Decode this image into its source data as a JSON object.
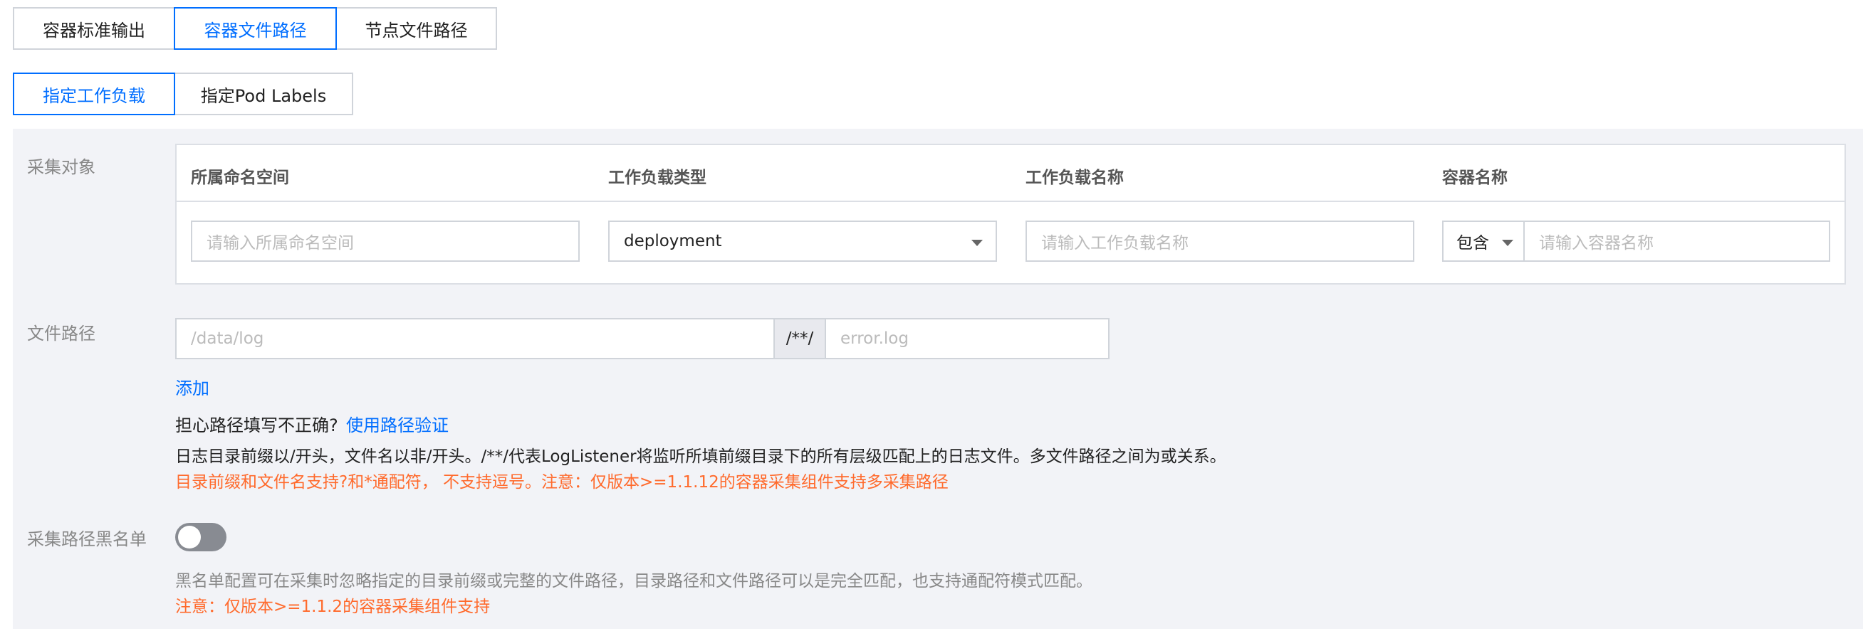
{
  "tabs_source": [
    {
      "label": "容器标准输出",
      "active": false
    },
    {
      "label": "容器文件路径",
      "active": true
    },
    {
      "label": "节点文件路径",
      "active": false
    }
  ],
  "tabs_target": [
    {
      "label": "指定工作负载",
      "active": true
    },
    {
      "label": "指定Pod Labels",
      "active": false
    }
  ],
  "collect_object": {
    "label": "采集对象",
    "headers": [
      "所属命名空间",
      "工作负载类型",
      "工作负载名称",
      "容器名称"
    ],
    "namespace_placeholder": "请输入所属命名空间",
    "workload_type_value": "deployment",
    "workload_name_placeholder": "请输入工作负载名称",
    "container_match_value": "包含",
    "container_name_placeholder": "请输入容器名称"
  },
  "file_path": {
    "label": "文件路径",
    "dir_placeholder": "/data/log",
    "separator": "/**/",
    "file_placeholder": "error.log",
    "add_link": "添加",
    "question": "担心路径填写不正确?",
    "verify_link": "使用路径验证",
    "hint": "日志目录前缀以/开头，文件名以非/开头。/**/代表LogListener将监听所填前缀目录下的所有层级匹配上的日志文件。多文件路径之间为或关系。",
    "warning": "目录前缀和文件名支持?和*通配符， 不支持逗号。注意：仅版本>=1.1.12的容器采集组件支持多采集路径"
  },
  "blacklist": {
    "label": "采集路径黑名单",
    "enabled": false,
    "hint": "黑名单配置可在采集时忽略指定的目录前缀或完整的文件路径，目录路径和文件路径可以是完全匹配，也支持通配符模式匹配。",
    "warning": "注意：仅版本>=1.1.2的容器采集组件支持"
  },
  "colors": {
    "accent": "#006eff",
    "warning": "#ff6a2c",
    "panel_bg": "#f2f3f7"
  }
}
